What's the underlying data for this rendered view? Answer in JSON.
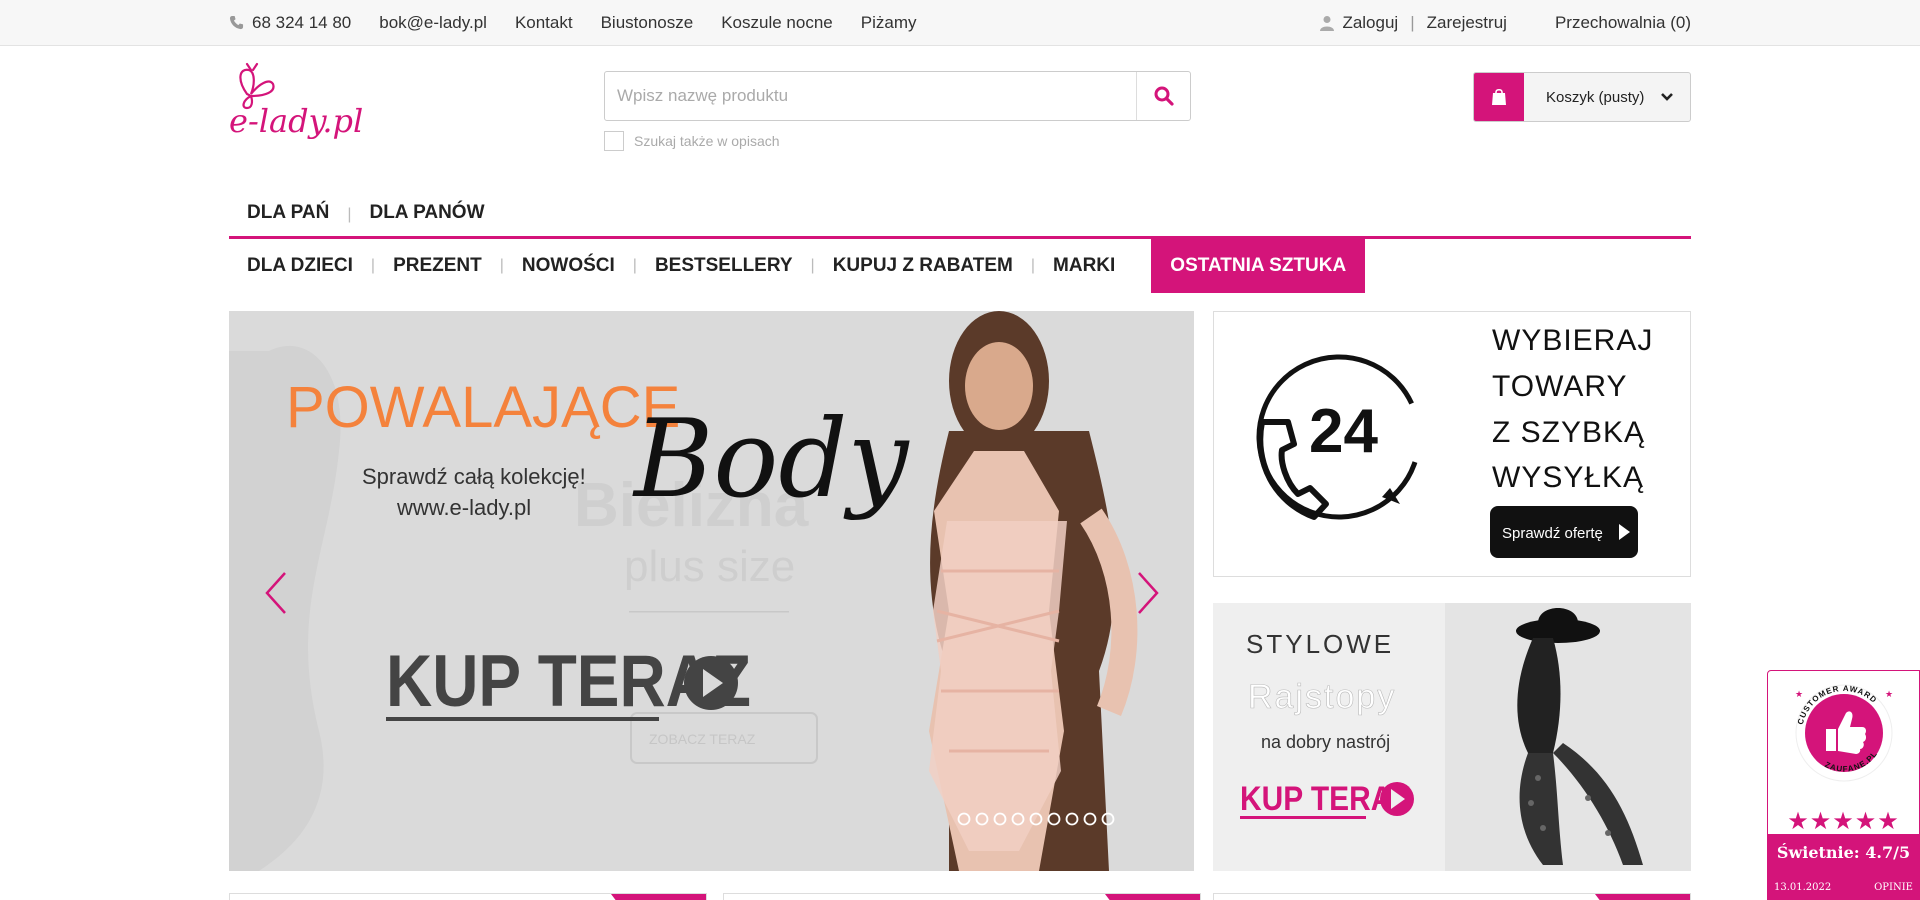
{
  "topbar": {
    "phone": "68 324 14 80",
    "email": "bok@e-lady.pl",
    "links": [
      "Kontakt",
      "Biustonosze",
      "Koszule nocne",
      "Piżamy"
    ],
    "login": "Zaloguj",
    "register": "Zarejestruj",
    "storage": "Przechowalnia (0)"
  },
  "header": {
    "logo_text": "e-lady.pl",
    "search_placeholder": "Wpisz nazwę produktu",
    "search_desc_label": "Szukaj także w opisach",
    "cart_label": "Koszyk (pusty)"
  },
  "nav_primary": [
    "DLA PAŃ",
    "DLA PANÓW"
  ],
  "nav_secondary": [
    "DLA DZIECI",
    "PREZENT",
    "NOWOŚCI",
    "BESTSELLERY",
    "KUPUJ Z RABATEM",
    "MARKI"
  ],
  "nav_active": "OSTATNIA SZTUKA",
  "slider": {
    "headline": "POWALAJĄCE",
    "script_word": "Body",
    "subtitle_1": "Sprawdź całą kolekcję!",
    "subtitle_2": "www.e-lady.pl",
    "ghost_text_1": "Bielizna",
    "ghost_text_2": "plus size",
    "ghost_button": "ZOBACZ TERAZ",
    "cta": "KUP TERAZ",
    "dot_count": 9
  },
  "side_banner_1": {
    "badge_number": "24",
    "lines": [
      "WYBIERAJ",
      "TOWARY",
      "Z SZYBKĄ",
      "WYSYŁKĄ"
    ],
    "button": "Sprawdź ofertę"
  },
  "side_banner_2": {
    "line_1": "STYLOWE",
    "line_2": "Rajstopy",
    "line_3": "na dobry nastrój",
    "cta": "KUP TERAZ"
  },
  "award": {
    "ring_text_top": "CUSTOMER AWARD",
    "ring_text_bottom": "ZAUFANE.PL",
    "rating_text": "Świetnie: 4.7/5",
    "date": "13.01.2022",
    "reviews_label": "OPINIE",
    "stars": 4.7
  },
  "colors": {
    "brand": "#d4147a",
    "headline_orange": "#f4823c"
  }
}
